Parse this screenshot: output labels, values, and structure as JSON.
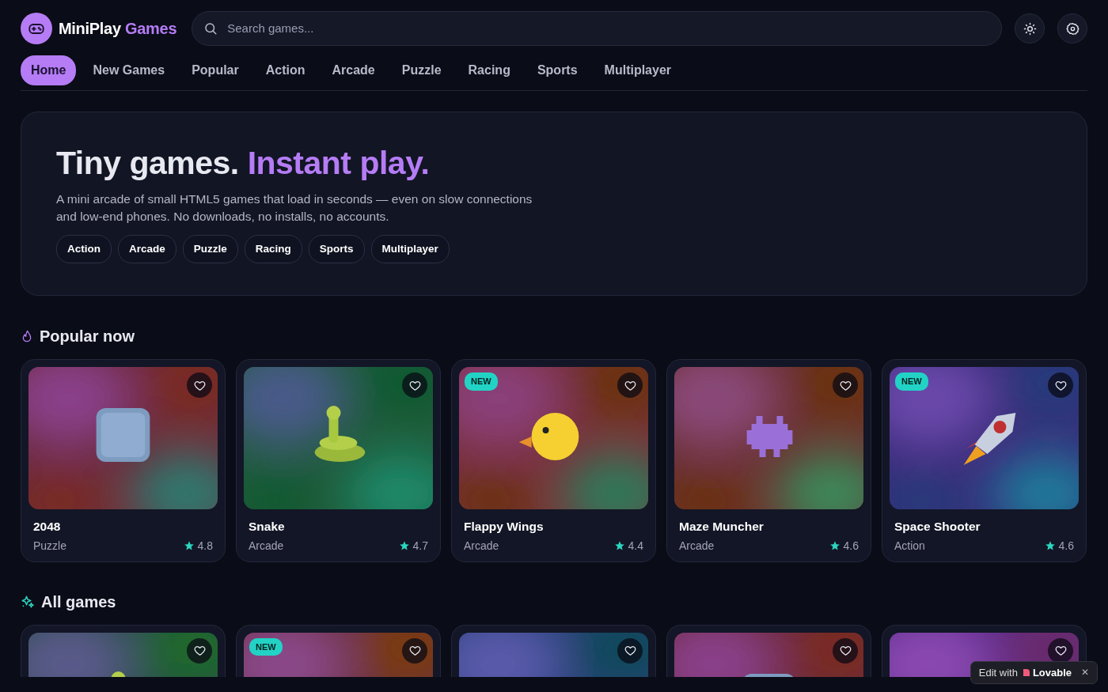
{
  "brand": {
    "name": "MiniPlay",
    "accent": "Games"
  },
  "search": {
    "placeholder": "Search games..."
  },
  "nav": [
    {
      "label": "Home",
      "selected": true
    },
    {
      "label": "New Games",
      "selected": false
    },
    {
      "label": "Popular",
      "selected": false
    },
    {
      "label": "Action",
      "selected": false
    },
    {
      "label": "Arcade",
      "selected": false
    },
    {
      "label": "Puzzle",
      "selected": false
    },
    {
      "label": "Racing",
      "selected": false
    },
    {
      "label": "Sports",
      "selected": false
    },
    {
      "label": "Multiplayer",
      "selected": false
    }
  ],
  "hero": {
    "title": "Tiny games.",
    "title_accent": "Instant play.",
    "text": "A mini arcade of small HTML5 games that load in seconds — even on slow connections and low-end phones. No downloads, no installs, no accounts.",
    "chips": [
      "Action",
      "Arcade",
      "Puzzle",
      "Racing",
      "Sports",
      "Multiplayer"
    ]
  },
  "popular": {
    "title": "Popular now",
    "games": [
      {
        "name": "2048",
        "category": "Puzzle",
        "rating": "4.8",
        "favorite": false
      },
      {
        "name": "Snake",
        "category": "Arcade",
        "rating": "4.7",
        "favorite": false
      },
      {
        "name": "Flappy Wings",
        "category": "Arcade",
        "rating": "4.4",
        "badge": "NEW",
        "favorite": false
      },
      {
        "name": "Maze Muncher",
        "category": "Arcade",
        "rating": "4.6",
        "favorite": false
      },
      {
        "name": "Space Shooter",
        "category": "Action",
        "rating": "4.6",
        "badge": "NEW",
        "favorite": false
      }
    ]
  },
  "all_games": {
    "title": "All games",
    "games": [
      {
        "favorite": false
      },
      {
        "badge": "NEW",
        "favorite": false
      },
      {
        "favorite": false
      },
      {
        "favorite": false
      },
      {
        "favorite": false
      }
    ]
  },
  "edit_badge": {
    "text": "Edit with",
    "brand": "Lovable",
    "close": "✕"
  }
}
